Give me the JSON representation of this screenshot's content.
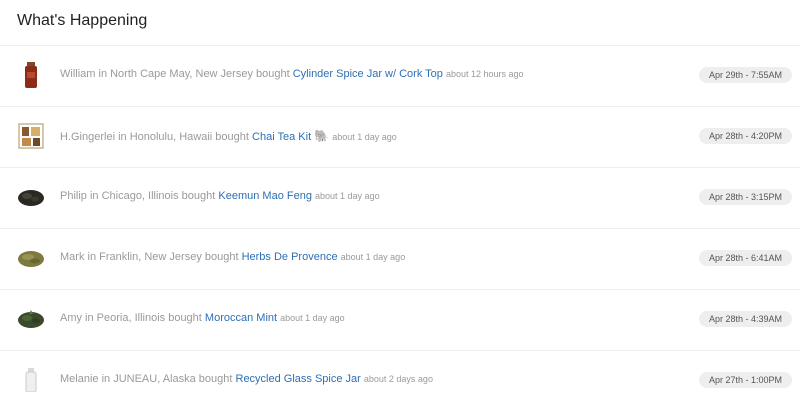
{
  "page": {
    "title": "What's Happening"
  },
  "feed": [
    {
      "prefix": "William in North Cape May, New Jersey bought",
      "product": "Cylinder Spice Jar w/ Cork Top",
      "emoji": "",
      "ago": "about 12 hours ago",
      "time": "Apr 29th - 7:55AM",
      "icon": "spice-jar-icon"
    },
    {
      "prefix": "H.Gingerlei in Honolulu, Hawaii bought",
      "product": "Chai Tea Kit",
      "emoji": "🐘",
      "ago": "about 1 day ago",
      "time": "Apr 28th - 4:20PM",
      "icon": "tea-kit-icon"
    },
    {
      "prefix": "Philip in Chicago, Illinois bought",
      "product": "Keemun Mao Feng",
      "emoji": "",
      "ago": "about 1 day ago",
      "time": "Apr 28th - 3:15PM",
      "icon": "tea-leaves-icon"
    },
    {
      "prefix": "Mark in Franklin, New Jersey bought",
      "product": "Herbs De Provence",
      "emoji": "",
      "ago": "about 1 day ago",
      "time": "Apr 28th - 6:41AM",
      "icon": "herbs-icon"
    },
    {
      "prefix": "Amy in Peoria, Illinois bought",
      "product": "Moroccan Mint",
      "emoji": "",
      "ago": "about 1 day ago",
      "time": "Apr 28th - 4:39AM",
      "icon": "mint-leaves-icon"
    },
    {
      "prefix": "Melanie in JUNEAU, Alaska bought",
      "product": "Recycled Glass Spice Jar",
      "emoji": "",
      "ago": "about 2 days ago",
      "time": "Apr 27th - 1:00PM",
      "icon": "glass-jar-icon"
    }
  ]
}
